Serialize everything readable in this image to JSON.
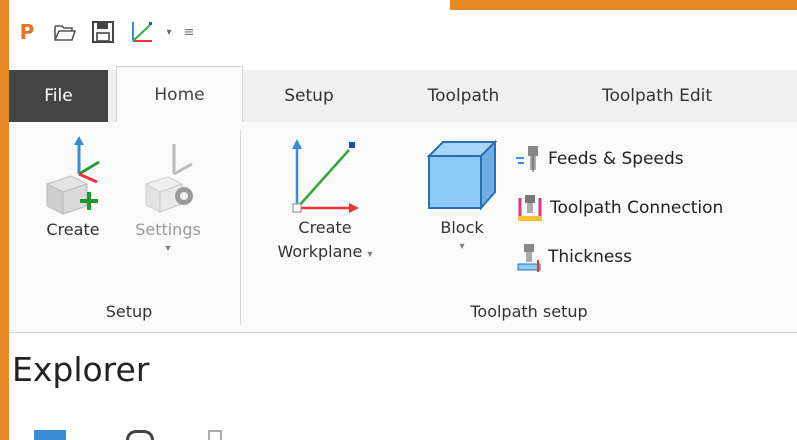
{
  "colors": {
    "frame_accent": "#e88a24",
    "file_tab_bg": "#444444",
    "ribbon_bg": "#fafafa"
  },
  "qat": {
    "logo": "P",
    "icons": [
      "open-folder-icon",
      "save-icon",
      "workplane-icon",
      "chevron-down-icon",
      "customize-icon"
    ]
  },
  "tabs": [
    "File",
    "Home",
    "Setup",
    "Toolpath",
    "Toolpath Edit"
  ],
  "ribbon": {
    "setup_group": {
      "label": "Setup",
      "buttons": [
        {
          "label": "Create",
          "icon": "create-workplane-axes-icon",
          "enabled": true
        },
        {
          "label": "Settings",
          "icon": "settings-gear-icon",
          "enabled": false
        }
      ]
    },
    "toolpath_setup_group": {
      "label": "Toolpath setup",
      "create_workplane": {
        "label_line1": "Create",
        "label_line2": "Workplane"
      },
      "block": {
        "label": "Block"
      },
      "small_buttons": [
        {
          "label": "Feeds & Speeds",
          "icon": "feeds-speeds-icon"
        },
        {
          "label": "Toolpath Connection",
          "icon": "toolpath-connections-icon"
        },
        {
          "label": "Thickness",
          "icon": "thickness-icon"
        }
      ]
    }
  },
  "explorer": {
    "title": "Explorer"
  }
}
